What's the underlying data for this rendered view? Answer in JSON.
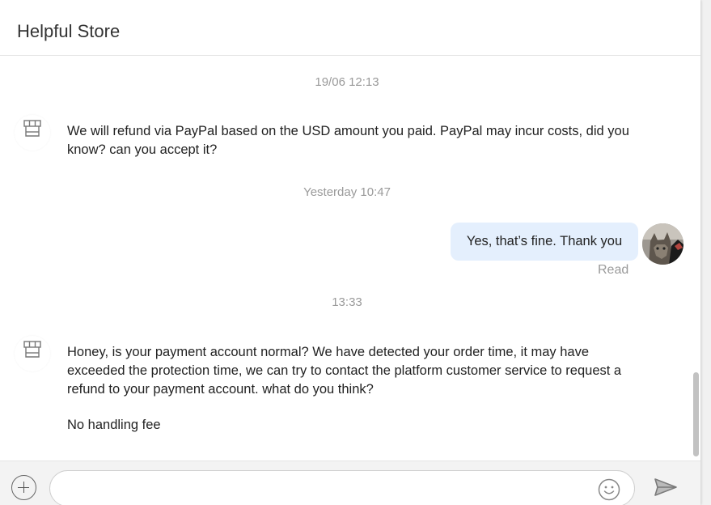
{
  "header": {
    "title": "Helpful Store"
  },
  "messages": [
    {
      "type": "timestamp",
      "text": "19/06 12:13"
    },
    {
      "type": "incoming",
      "avatar_icon": "store-icon",
      "lines": [
        "We will refund via PayPal based on the USD amount you paid. PayPal may incur costs, did you know? can you accept it?"
      ]
    },
    {
      "type": "timestamp",
      "text": "Yesterday 10:47"
    },
    {
      "type": "outgoing",
      "text": "Yes, that’s fine. Thank you",
      "status": "Read"
    },
    {
      "type": "timestamp",
      "text": "13:33"
    },
    {
      "type": "incoming",
      "avatar_icon": "store-icon",
      "lines": [
        "Honey, is your payment account normal? We have detected your order time, it may have exceeded the protection time, we can try to contact the platform customer service to request a refund to your payment account. what do you think?",
        "No handling fee"
      ]
    }
  ],
  "composer": {
    "placeholder": "",
    "value": "",
    "add_icon": "plus-circle-icon",
    "emoji_icon": "smiley-icon",
    "send_icon": "send-arrow-icon"
  },
  "colors": {
    "outgoing_bubble": "#e4effd",
    "timestamp": "#9a9a9a",
    "text": "#222222"
  }
}
